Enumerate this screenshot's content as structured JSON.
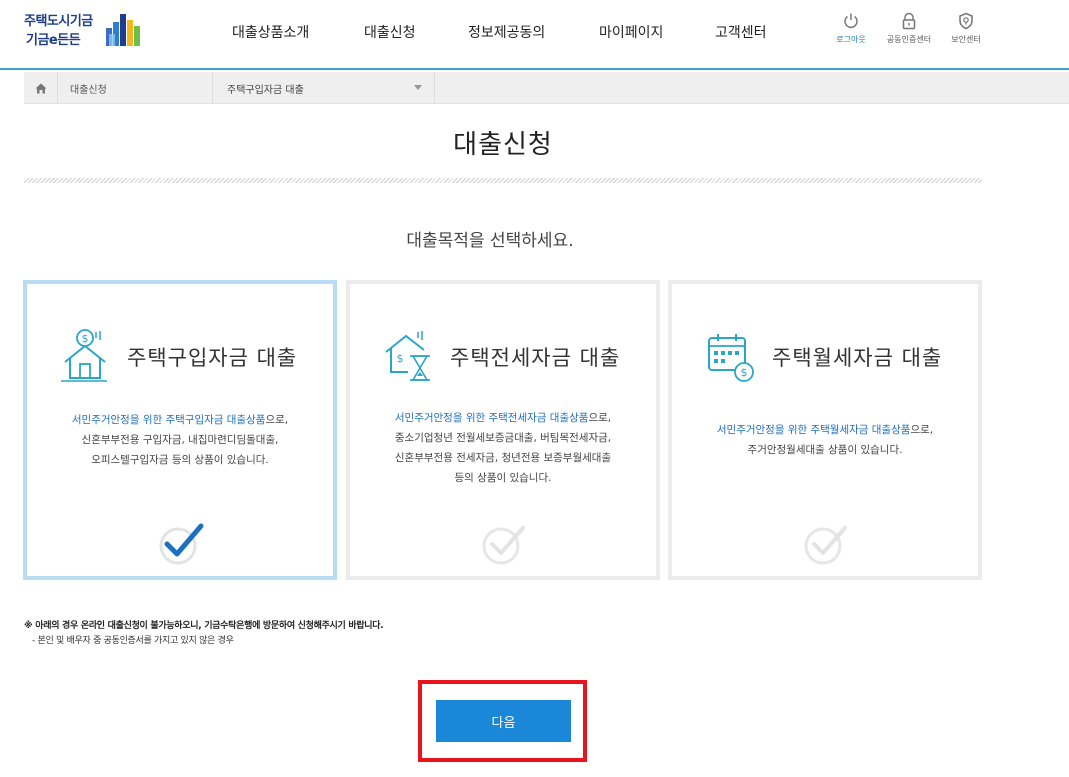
{
  "header": {
    "logo_line1": "주택도시기금",
    "logo_line2": "기금e든든",
    "nav": [
      "대출상품소개",
      "대출신청",
      "정보제공동의",
      "마이페이지",
      "고객센터"
    ],
    "util": [
      {
        "label": "로그아웃",
        "icon": "power-icon",
        "active": true
      },
      {
        "label": "공동인증센터",
        "icon": "lock-icon",
        "active": false
      },
      {
        "label": "보안센터",
        "icon": "shield-icon",
        "active": false
      }
    ],
    "accent_color": "#39a3c8"
  },
  "breadcrumb": {
    "home_icon": "home-icon",
    "item1": "대출신청",
    "select_value": "주택구입자금 대출"
  },
  "page_title": "대출신청",
  "subtitle": "대출목적을 선택하세요.",
  "cards": [
    {
      "title": "주택구입자금 대출",
      "icon": "house-coin-icon",
      "desc_highlight": "서민주거안정을 위한 주택구입자금 대출상품",
      "desc_rest": "으로,",
      "desc_lines": [
        "신혼부부전용 구입자금, 내집마련디딤돌대출,",
        "오피스텔구입자금 등의 상품이 있습니다."
      ],
      "selected": true
    },
    {
      "title": "주택전세자금 대출",
      "icon": "house-hourglass-icon",
      "desc_highlight": "서민주거안정을 위한 주택전세자금 대출상품",
      "desc_rest": "으로,",
      "desc_lines": [
        "중소기업청년 전월세보증금대출, 버팀목전세자금,",
        "신혼부부전용 전세자금, 청년전용 보증부월세대출",
        "등의 상품이 있습니다."
      ],
      "selected": false
    },
    {
      "title": "주택월세자금 대출",
      "icon": "calendar-coin-icon",
      "desc_highlight": "서민주거안정을 위한 주택월세자금 대출상품",
      "desc_rest": "으로,",
      "desc_lines": [
        "주거안정월세대출 상품이 있습니다."
      ],
      "selected": false
    }
  ],
  "notice": {
    "line1": "※ 아래의 경우 온라인 대출신청이 불가능하오니, 기금수탁은행에 방문하여 신청해주시기 바랍니다.",
    "line2": "- 본인 및 배우자 중 공동인증서를 가지고 있지 않은 경우"
  },
  "next_button": "다음",
  "colors": {
    "primary_button": "#1b87d8",
    "highlight_box": "#e8151c",
    "selected_border": "#b9dcf2",
    "link_blue": "#1d6fbf"
  }
}
